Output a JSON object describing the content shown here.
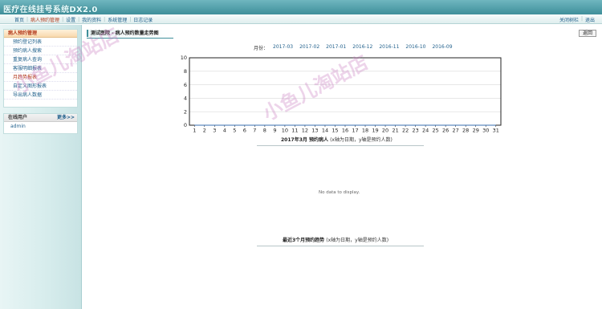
{
  "header": {
    "title": "医疗在线挂号系统DX2.0"
  },
  "menu": {
    "items": [
      {
        "label": "首页"
      },
      {
        "label": "病人预约管理",
        "active": true
      },
      {
        "label": "设置"
      },
      {
        "label": "我的资料"
      },
      {
        "label": "系统管理"
      },
      {
        "label": "日志记录"
      }
    ],
    "right": [
      {
        "label": "关闭树栏"
      },
      {
        "label": "退出"
      }
    ]
  },
  "sidebar": {
    "section_title": "病人预约管理",
    "items": [
      {
        "label": "预约登记列表"
      },
      {
        "label": "预约病人搜索"
      },
      {
        "label": "重复病人查询"
      },
      {
        "label": "客服明细报表"
      },
      {
        "label": "月趋势报表",
        "active": true
      },
      {
        "label": "自定义图形报表"
      },
      {
        "label": "导出病人数据"
      }
    ],
    "online": {
      "title": "在线用户",
      "more": "更多>>",
      "users": [
        "admin"
      ]
    }
  },
  "main": {
    "breadcrumb": "测试医院 - 病人预约数量走势图",
    "back_label": "返回",
    "month_label": "月份：",
    "months": [
      "2017-03",
      "2017-02",
      "2017-01",
      "2016-12",
      "2016-11",
      "2016-10",
      "2016-09"
    ],
    "no_data": "No data to display."
  },
  "watermark": "小鱼儿淘站店",
  "chart_data": [
    {
      "type": "line",
      "title": "2017年3月 预约病人",
      "subtitle": "(x轴为日期，y轴是预约人数)",
      "x": [
        1,
        2,
        3,
        4,
        5,
        6,
        7,
        8,
        9,
        10,
        11,
        12,
        13,
        14,
        15,
        16,
        17,
        18,
        19,
        20,
        21,
        22,
        23,
        24,
        25,
        26,
        27,
        28,
        29,
        30,
        31
      ],
      "y": [
        0,
        0,
        0,
        0,
        0,
        0,
        0,
        0,
        0,
        0,
        0,
        0,
        0,
        0,
        0,
        0,
        0,
        0,
        0,
        0,
        0,
        0,
        0,
        0,
        0,
        0,
        0,
        0,
        0,
        0,
        0
      ],
      "ylim": [
        0,
        10
      ],
      "yticks": [
        0,
        2,
        4,
        6,
        8,
        10
      ],
      "grid": true
    },
    {
      "type": "line",
      "title": "最近3个月预约趋势",
      "subtitle": "(x轴为日期，y轴是预约人数)",
      "series": [],
      "no_data_text": "No data to display."
    }
  ]
}
